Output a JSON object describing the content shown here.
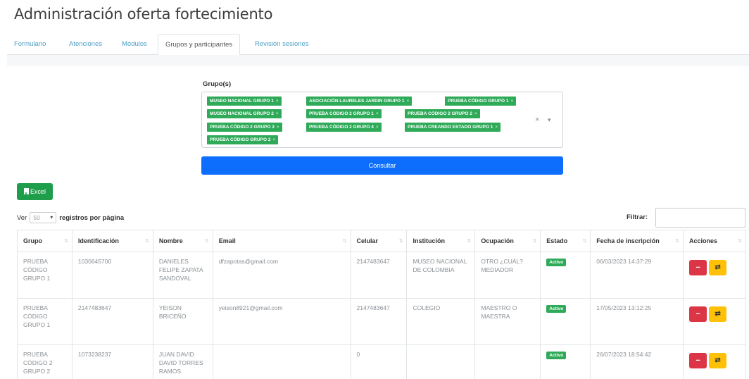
{
  "page": {
    "title": "Administración oferta fortecimiento"
  },
  "tabs": [
    {
      "label": "Formulario"
    },
    {
      "label": "Atenciones"
    },
    {
      "label": "Módulos"
    },
    {
      "label": "Grupos y participantes"
    },
    {
      "label": "Revisión sesiones"
    }
  ],
  "active_tab": "Grupos y participantes",
  "filter": {
    "label": "Grupo(s)",
    "chips": [
      "MUSEO NACIONAL GRUPO 1",
      "ASOCIACIÓN LAURELES JARDIN GRUPO 1",
      "PRUEBA CÓDIGO GRUPO 1",
      "MUSEO NACIONAL GRUPO 2",
      "PRUEBA CÓDIGO 2 GRUPO 1",
      "PRUEBA CÓDIGO 2 GRUPO 2",
      "PRUEBA CÓDIGO 2 GRUPO 3",
      "PRUEBA CÓDIGO 2 GRUPO 4",
      "PRUEBA CREANDO ESTADO GRUPO 1",
      "PRUEBA CÓDIGO GRUPO 2"
    ],
    "chip_remove": "×",
    "clear": "×",
    "caret": "▾",
    "submit_label": "Consultar"
  },
  "excel_label": "Excel",
  "pagination": {
    "prefix": "Ver",
    "value": "50",
    "suffix": "registros por página"
  },
  "search": {
    "label": "Filtrar:",
    "value": ""
  },
  "table": {
    "columns": [
      "Grupo",
      "Identificación",
      "Nombre",
      "Email",
      "Celular",
      "Institución",
      "Ocupación",
      "Estado",
      "Fecha de inscripción",
      "Acciones"
    ],
    "rows": [
      [
        "PRUEBA CÓDIGO GRUPO 1",
        "1030645700",
        "DANIELES FELIPE ZAPATA SANDOVAL",
        "dfzapotas@gmail.com",
        "2147483647",
        "MUSEO NACIONAL DE COLOMBIA",
        "OTRO ¿CUÁL? MEDIADOR",
        "Activo",
        "06/03/2023 14:37:29"
      ],
      [
        "PRUEBA CÓDIGO GRUPO 1",
        "2147483647",
        "YEISON BRICEÑO",
        "yeison8921@gmail.com",
        "2147483647",
        "COLEGIO",
        "MAESTRO O MAESTRA",
        "Activo",
        "17/05/2023 13:12:25"
      ],
      [
        "PRUEBA CÓDIGO 2 GRUPO 2",
        "1073238237",
        "JUAN DAVID DAVID TORRES RAMOS",
        "",
        "0",
        "",
        "",
        "Activo",
        "26/07/2023 18:54:42"
      ]
    ],
    "action_delete": "−",
    "action_swap": "⇄"
  }
}
